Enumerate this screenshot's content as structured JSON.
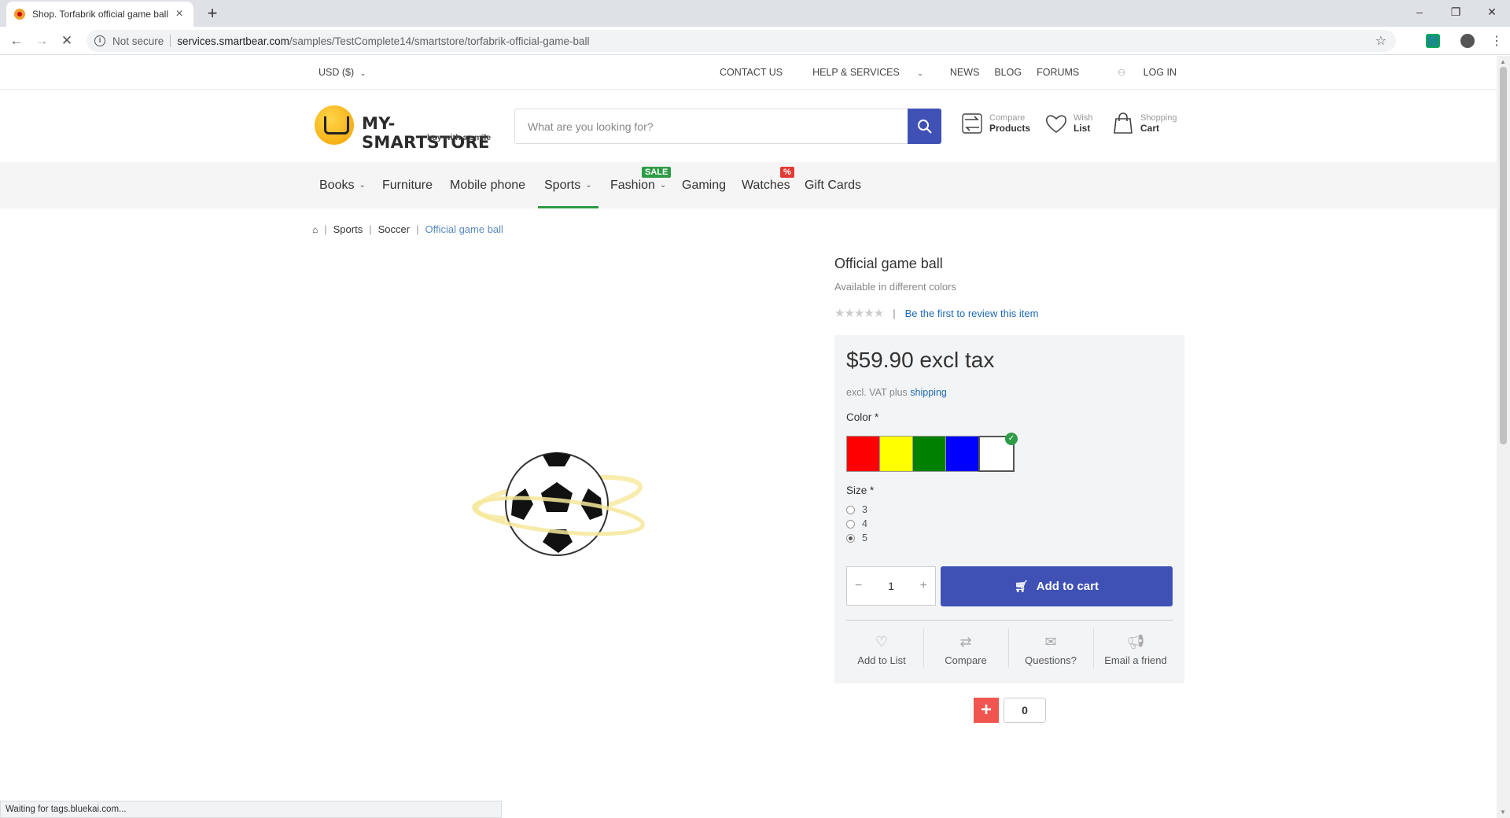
{
  "browser": {
    "tab_title": "Shop. Torfabrik official game ball",
    "not_secure": "Not secure",
    "url_host": "services.smartbear.com",
    "url_path": "/samples/TestComplete14/smartstore/torfabrik-official-game-ball",
    "status": "Waiting for tags.bluekai.com..."
  },
  "topbar": {
    "currency": "USD  ($)",
    "links": [
      "CONTACT US",
      "HELP & SERVICES",
      "NEWS",
      "BLOG",
      "FORUMS",
      "LOG IN"
    ]
  },
  "header": {
    "logo_name": "MY-SMARTSTORE",
    "logo_tagline": "buy with a smile",
    "search_placeholder": "What are you looking for?",
    "compare_top": "Compare",
    "compare_bottom": "Products",
    "wish_top": "Wish",
    "wish_bottom": "List",
    "cart_top": "Shopping",
    "cart_bottom": "Cart"
  },
  "nav": {
    "items": [
      "Books",
      "Furniture",
      "Mobile phone",
      "Sports",
      "Fashion",
      "Gaming",
      "Watches",
      "Gift Cards"
    ],
    "fashion_tag": "SALE",
    "watches_tag": "%"
  },
  "breadcrumb": {
    "items": [
      "Sports",
      "Soccer",
      "Official game ball"
    ]
  },
  "product": {
    "name": "Official game ball",
    "subtitle": "Available in different colors",
    "review_link": "Be the first to review this item",
    "price": "$59.90 excl tax",
    "vat_text": "excl. VAT plus",
    "shipping_link": "shipping",
    "color_label": "Color *",
    "colors": [
      "#ff0000",
      "#ffff00",
      "#008000",
      "#0000ff",
      "#ffffff"
    ],
    "size_label": "Size *",
    "sizes": [
      "3",
      "4",
      "5"
    ],
    "selected_size": "5",
    "quantity": "1",
    "add_to_cart": "Add to cart",
    "actions": [
      "Add to List",
      "Compare",
      "Questions?",
      "Email a friend"
    ],
    "share_count": "0"
  },
  "colors": {
    "accent": "#3f51b5",
    "active_nav": "#2e9b46",
    "sale_tag": "#2e9b46",
    "percent_tag": "#e53935"
  }
}
